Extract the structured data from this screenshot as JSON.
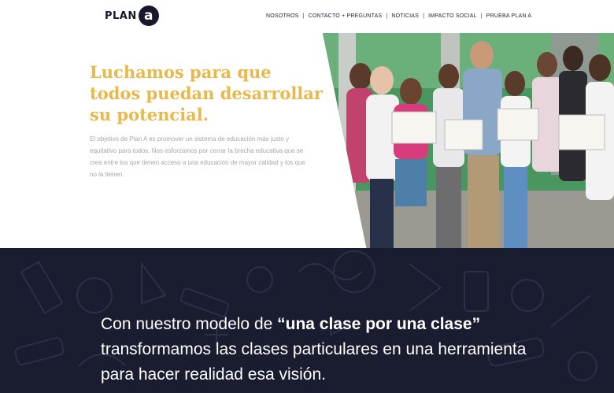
{
  "header": {
    "logo_word": "PLAN",
    "logo_letter": "a",
    "nav": [
      {
        "label": "NOSOTROS"
      },
      {
        "label": "CONTACTO + PREGUNTAS"
      },
      {
        "label": "NOTICIAS"
      },
      {
        "label": "IMPACTO SOCIAL"
      },
      {
        "label": "PRUEBA PLAN A"
      }
    ],
    "separator": "|"
  },
  "hero": {
    "headline": "Luchamos para que todos puedan desarrollar su potencial.",
    "body": "El objetivo de Plan A es promover un sistema de educación más justo y equitativo para todos. Nos esforzamos por cerrar la brecha educativa que se crea entre los que tienen acceso a una educación de mayor calidad y los que no la tienen."
  },
  "band": {
    "quote_pre": "Con nuestro modelo de ",
    "quote_bold": "“una clase por una clase”",
    "quote_post": " transformamos las clases particulares en una herramienta para hacer realidad esa visión."
  },
  "colors": {
    "accent": "#e8b84b",
    "dark": "#1a1c30",
    "body_text": "#a5a5ad"
  }
}
